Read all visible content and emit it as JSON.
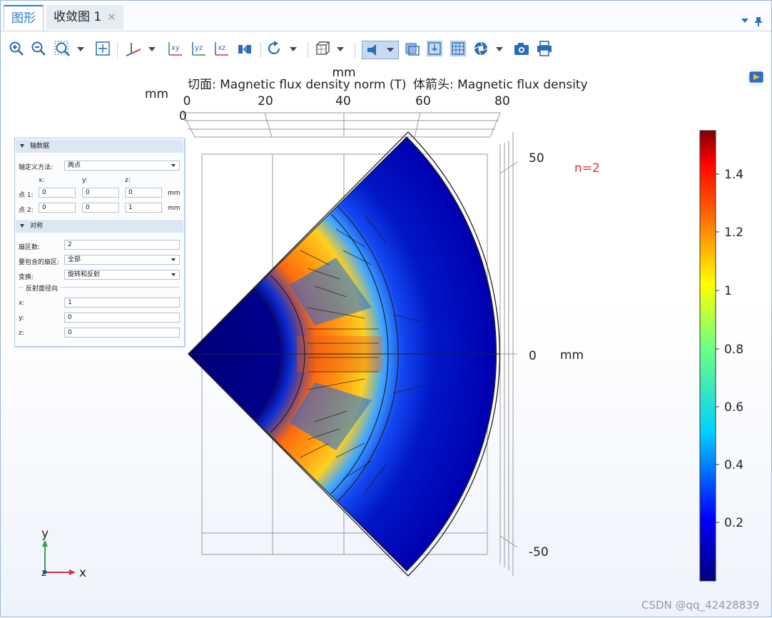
{
  "tabs": [
    {
      "label": "图形"
    },
    {
      "label": "收敛图 1"
    }
  ],
  "plot": {
    "title_slice": "切面: Magnetic flux density norm (T)",
    "title_arrow": "体箭头: Magnetic flux density",
    "annotation": "n=2",
    "x_axis": {
      "label": "mm",
      "ticks": [
        "0",
        "20",
        "40",
        "60",
        "80"
      ]
    },
    "y_axis": {
      "label": "mm",
      "ticks": [
        "50",
        "0",
        "-50"
      ]
    },
    "z_axis": {
      "label": "mm",
      "ticks": [
        "0"
      ]
    },
    "colorbar": {
      "ticks": [
        "1.4",
        "1.2",
        "1",
        "0.8",
        "0.6",
        "0.4",
        "0.2"
      ],
      "min": 0,
      "max": 1.55
    }
  },
  "axis_triad": {
    "y": "y",
    "x": "x",
    "z": "z"
  },
  "panel": {
    "section_axis": "轴数据",
    "axis_method_label": "轴定义方法:",
    "axis_method_value": "两点",
    "col_x": "x:",
    "col_y": "y:",
    "col_z": "z:",
    "point1_label": "点 1:",
    "point1": [
      "0",
      "0",
      "0"
    ],
    "point2_label": "点 2:",
    "point2": [
      "0",
      "0",
      "1"
    ],
    "unit": "mm",
    "section_symmetry": "对称",
    "sectors_label": "扇区数:",
    "sectors_value": "2",
    "include_label": "要包含的扇区:",
    "include_value": "全部",
    "transform_label": "变换:",
    "transform_value": "旋转和反射",
    "reflect_group": "反射面径向",
    "rx_label": "x:",
    "rx_value": "1",
    "ry_label": "y:",
    "ry_value": "0",
    "rz_label": "z:",
    "rz_value": "0"
  },
  "watermark": "CSDN @qq_42428839"
}
